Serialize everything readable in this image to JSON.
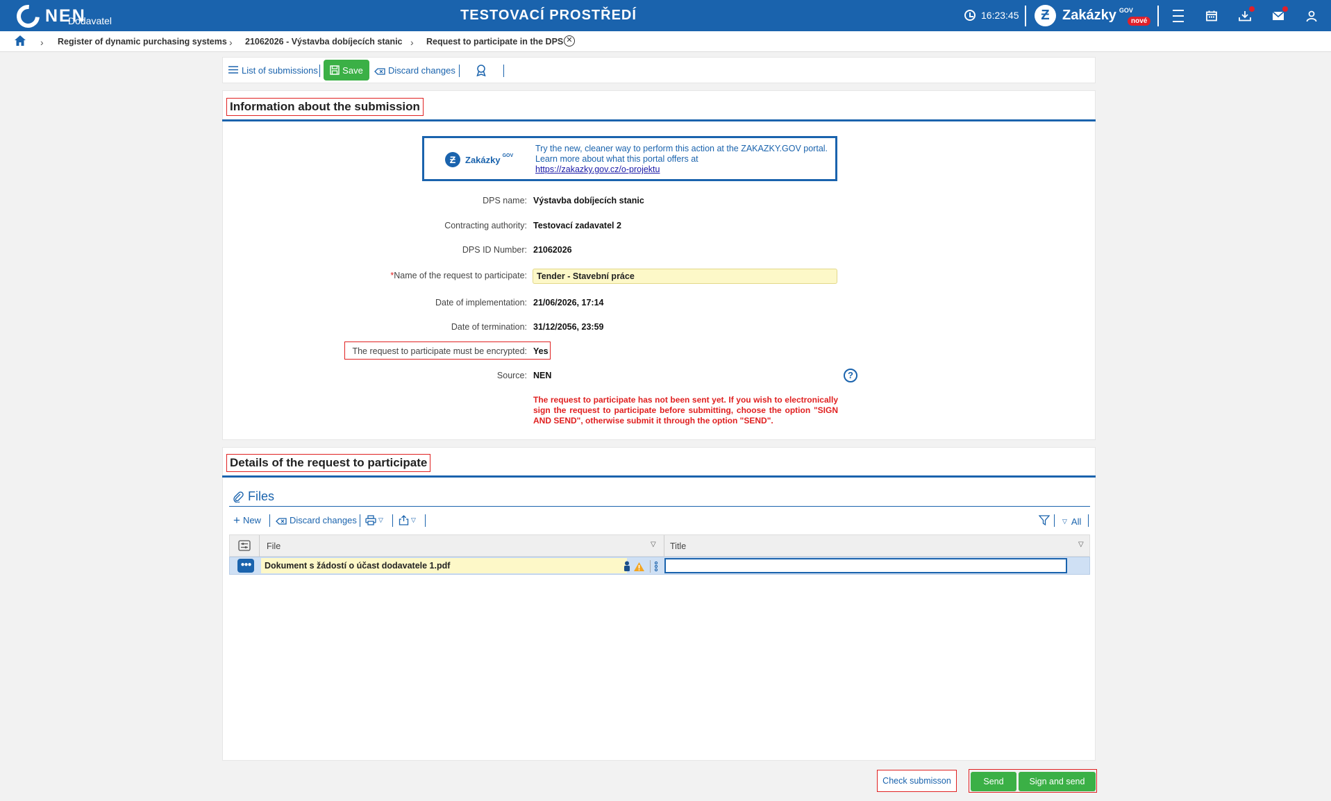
{
  "header": {
    "logo_text": "NEN",
    "logo_sub": "Dodavatel",
    "env_title": "TESTOVACÍ PROSTŘEDÍ",
    "clock": "16:23:45",
    "zakazky_name": "Zakázky",
    "zakazky_gov": "GOV",
    "zakazky_badge": "nové"
  },
  "breadcrumb": {
    "items": [
      "Register of dynamic purchasing systems",
      "21062026 - Výstavba dobíjecích stanic",
      "Request to participate in the DPS"
    ]
  },
  "toolbar": {
    "list_label": "List of submissions",
    "save_label": "Save",
    "discard_label": "Discard changes"
  },
  "info_section": {
    "title": "Information about the submission",
    "promo": {
      "brand": "Zakázky",
      "brand_gov": "GOV",
      "line1": "Try the new, cleaner way to perform this action at the ZAKAZKY.GOV portal.",
      "line2": "Learn more about what this portal offers at",
      "link": "https://zakazky.gov.cz/o-projektu"
    },
    "fields": {
      "dps_name_label": "DPS name:",
      "dps_name": "Výstavba dobíjecích stanic",
      "authority_label": "Contracting authority:",
      "authority": "Testovací zadavatel 2",
      "dps_id_label": "DPS ID Number:",
      "dps_id": "21062026",
      "req_name_label": "Name of the request to participate:",
      "req_name": "Tender - Stavební práce",
      "impl_label": "Date of implementation:",
      "impl": "21/06/2026, 17:14",
      "term_label": "Date of termination:",
      "term": "31/12/2056, 23:59",
      "encrypted_label": "The request to participate must be encrypted:",
      "encrypted": "Yes",
      "source_label": "Source:",
      "source": "NEN"
    },
    "warning": "The request to participate has not been sent yet. If you wish to electronically sign the request to participate before submitting, choose the option \"SIGN AND SEND\", otherwise submit it through the option \"SEND\"."
  },
  "details_section": {
    "title": "Details of the request to participate",
    "files_title": "Files",
    "new_label": "New",
    "discard_label": "Discard changes",
    "filter_all": "All",
    "columns": [
      "File",
      "Title"
    ],
    "rows": [
      {
        "file": "Dokument s žádostí o účast dodavatele 1.pdf",
        "title": ""
      }
    ]
  },
  "footer": {
    "check_label": "Check submisson",
    "send_label": "Send",
    "sign_send_label": "Sign and send"
  },
  "colors": {
    "brand_blue": "#1a63ad",
    "save_green": "#3bb046",
    "warning_red": "#e02020",
    "input_yellow": "#fdf8c8"
  }
}
